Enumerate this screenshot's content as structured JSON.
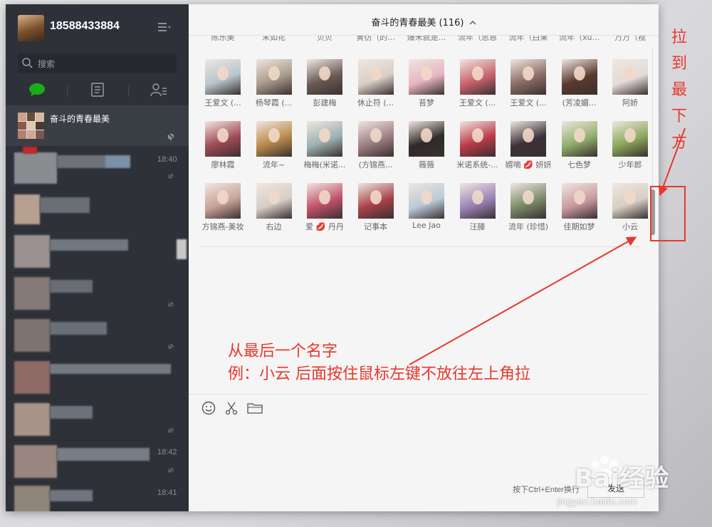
{
  "profile": {
    "phone": "18588433884"
  },
  "search": {
    "placeholder": "搜索"
  },
  "sessions": {
    "active_name": "奋斗的青春最美",
    "times": [
      "18:40",
      "18:42",
      "18:41"
    ]
  },
  "chat": {
    "title": "奋斗的青春最美 (116)"
  },
  "members_cut": [
    "陈乐美",
    "末如花",
    "贝贝",
    "黄彷（的...",
    "爆米就是...",
    "流年（思恩",
    "流年（白果",
    "流年（xu...",
    "万万（视"
  ],
  "members": [
    {
      "name": "王爱文 (...",
      "color": "#b7c6ce"
    },
    {
      "name": "杨琴霞 (...",
      "color": "#a89a8a"
    },
    {
      "name": "彭建梅",
      "color": "#6b5a55"
    },
    {
      "name": "休止符 (...",
      "color": "#d8d0c8"
    },
    {
      "name": "苔梦",
      "color": "#e7b5c0"
    },
    {
      "name": "王爱文 (...",
      "color": "#c9636e"
    },
    {
      "name": "王爱文 (...",
      "color": "#8a6d66"
    },
    {
      "name": "(芳凌媚...",
      "color": "#5a3a2e"
    },
    {
      "name": "阿娇",
      "color": "#e4dcd9"
    },
    {
      "name": "廖林霞",
      "color": "#a04a55"
    },
    {
      "name": "流年~",
      "color": "#b88a4a"
    },
    {
      "name": "梅梅(米诺...",
      "color": "#9cb0b0"
    },
    {
      "name": "(方锦燕...",
      "color": "#9c7e82"
    },
    {
      "name": "薇薇",
      "color": "#2f2a28"
    },
    {
      "name": "米诺系统-...",
      "color": "#b83a48"
    },
    {
      "name": "婿嘀 💋 妍妍",
      "color": "#3a3238"
    },
    {
      "name": "七色梦",
      "color": "#8fae6a"
    },
    {
      "name": "少年郎",
      "color": "#8aa85a"
    },
    {
      "name": "方锦燕-美妆",
      "color": "#c7a296"
    },
    {
      "name": "右边",
      "color": "#d6cdc6"
    },
    {
      "name": "爱 💋 丹丹",
      "color": "#c0506a"
    },
    {
      "name": "记事本",
      "color": "#a8404a"
    },
    {
      "name": "Lee Jao",
      "color": "#b8cad8"
    },
    {
      "name": "汪滕",
      "color": "#9a82b8"
    },
    {
      "name": "流年 (珍惜)",
      "color": "#7a8a6a"
    },
    {
      "name": "佳期如梦",
      "color": "#c89aa0"
    },
    {
      "name": "小云",
      "color": "#d6cfc4"
    }
  ],
  "toolbar": {
    "send_hint": "按下Ctrl+Enter换行",
    "send_label": "发送"
  },
  "annotations": {
    "right_vertical": [
      "拉",
      "到",
      "最",
      "下",
      "方"
    ],
    "line1": "从最后一个名字",
    "line2": "例：小云 后面按住鼠标左键不放往左上角拉",
    "color": "#e8372c"
  },
  "watermark": {
    "text": "Bai经验",
    "url": "jingyan.baidu.com"
  },
  "colors": {
    "sidebar": "#2e3238",
    "accent_green": "#1aad19"
  }
}
